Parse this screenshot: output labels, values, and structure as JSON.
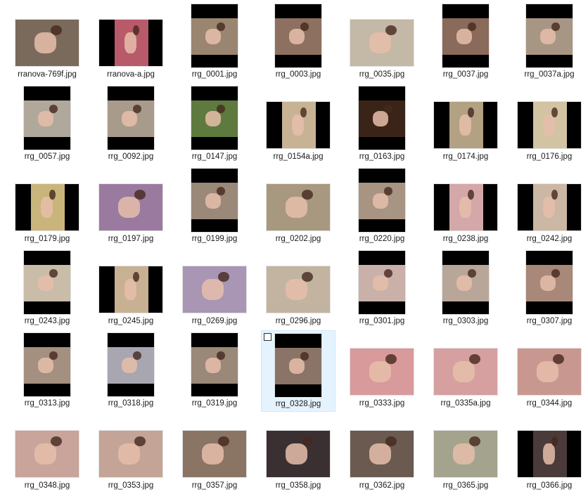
{
  "files": [
    {
      "name": "rranova-769f.jpg",
      "orient": "landscape",
      "color": "#7a6a5c"
    },
    {
      "name": "rranova-a.jpg",
      "orient": "landscape-bars",
      "color": "#b85a6a"
    },
    {
      "name": "rrg_0001.jpg",
      "orient": "portrait",
      "color": "#9a8670"
    },
    {
      "name": "rrg_0003.jpg",
      "orient": "portrait",
      "color": "#8d7060"
    },
    {
      "name": "rrg_0035.jpg",
      "orient": "landscape",
      "color": "#c4b8a6"
    },
    {
      "name": "rrg_0037.jpg",
      "orient": "portrait",
      "color": "#8a6a5a"
    },
    {
      "name": "rrg_0037a.jpg",
      "orient": "portrait",
      "color": "#a89684"
    },
    {
      "name": "rrg_0057.jpg",
      "orient": "portrait",
      "color": "#b0a89a"
    },
    {
      "name": "rrg_0092.jpg",
      "orient": "portrait",
      "color": "#a89b8c"
    },
    {
      "name": "rrg_0147.jpg",
      "orient": "portrait",
      "color": "#5e7a3e"
    },
    {
      "name": "rrg_0154a.jpg",
      "orient": "landscape-bars",
      "color": "#c7b294"
    },
    {
      "name": "rrg_0163.jpg",
      "orient": "portrait",
      "color": "#3a2418"
    },
    {
      "name": "rrg_0174.jpg",
      "orient": "landscape-bars",
      "color": "#b3a184"
    },
    {
      "name": "rrg_0176.jpg",
      "orient": "landscape-bars",
      "color": "#d2c4a2"
    },
    {
      "name": "rrg_0179.jpg",
      "orient": "landscape-bars",
      "color": "#c9b47c"
    },
    {
      "name": "rrg_0197.jpg",
      "orient": "landscape",
      "color": "#9b7aa0"
    },
    {
      "name": "rrg_0199.jpg",
      "orient": "portrait",
      "color": "#9a8878"
    },
    {
      "name": "rrg_0202.jpg",
      "orient": "landscape",
      "color": "#a89880"
    },
    {
      "name": "rrg_0220.jpg",
      "orient": "portrait",
      "color": "#a89482"
    },
    {
      "name": "rrg_0238.jpg",
      "orient": "landscape-bars",
      "color": "#d4a8a8"
    },
    {
      "name": "rrg_0242.jpg",
      "orient": "landscape-bars",
      "color": "#cbb7a4"
    },
    {
      "name": "rrg_0243.jpg",
      "orient": "portrait",
      "color": "#c9bca8"
    },
    {
      "name": "rrg_0245.jpg",
      "orient": "landscape-bars",
      "color": "#c8b092"
    },
    {
      "name": "rrg_0269.jpg",
      "orient": "landscape",
      "color": "#a896b4"
    },
    {
      "name": "rrg_0296.jpg",
      "orient": "landscape",
      "color": "#c2b4a0"
    },
    {
      "name": "rrg_0301.jpg",
      "orient": "portrait",
      "color": "#c9b0a8"
    },
    {
      "name": "rrg_0303.jpg",
      "orient": "portrait",
      "color": "#b8a698"
    },
    {
      "name": "rrg_0307.jpg",
      "orient": "portrait",
      "color": "#a88878"
    },
    {
      "name": "rrg_0313.jpg",
      "orient": "portrait",
      "color": "#a49080"
    },
    {
      "name": "rrg_0318.jpg",
      "orient": "portrait",
      "color": "#a8a6b0"
    },
    {
      "name": "rrg_0319.jpg",
      "orient": "portrait",
      "color": "#9a8878"
    },
    {
      "name": "rrg_0328.jpg",
      "orient": "portrait",
      "color": "#8a7468",
      "selected": true
    },
    {
      "name": "rrg_0333.jpg",
      "orient": "landscape",
      "color": "#d89a9a"
    },
    {
      "name": "rrg_0335a.jpg",
      "orient": "landscape",
      "color": "#d6a0a0"
    },
    {
      "name": "rrg_0344.jpg",
      "orient": "landscape",
      "color": "#c89890"
    },
    {
      "name": "rrg_0348.jpg",
      "orient": "landscape",
      "color": "#c8a49a"
    },
    {
      "name": "rrg_0353.jpg",
      "orient": "landscape",
      "color": "#c4a496"
    },
    {
      "name": "rrg_0357.jpg",
      "orient": "landscape",
      "color": "#8a7464"
    },
    {
      "name": "rrg_0358.jpg",
      "orient": "landscape",
      "color": "#3a3032"
    },
    {
      "name": "rrg_0362.jpg",
      "orient": "landscape",
      "color": "#6a5a50"
    },
    {
      "name": "rrg_0365.jpg",
      "orient": "landscape",
      "color": "#a4a48e"
    },
    {
      "name": "rrg_0366.jpg",
      "orient": "landscape-bars",
      "color": "#4a3a3a"
    }
  ]
}
